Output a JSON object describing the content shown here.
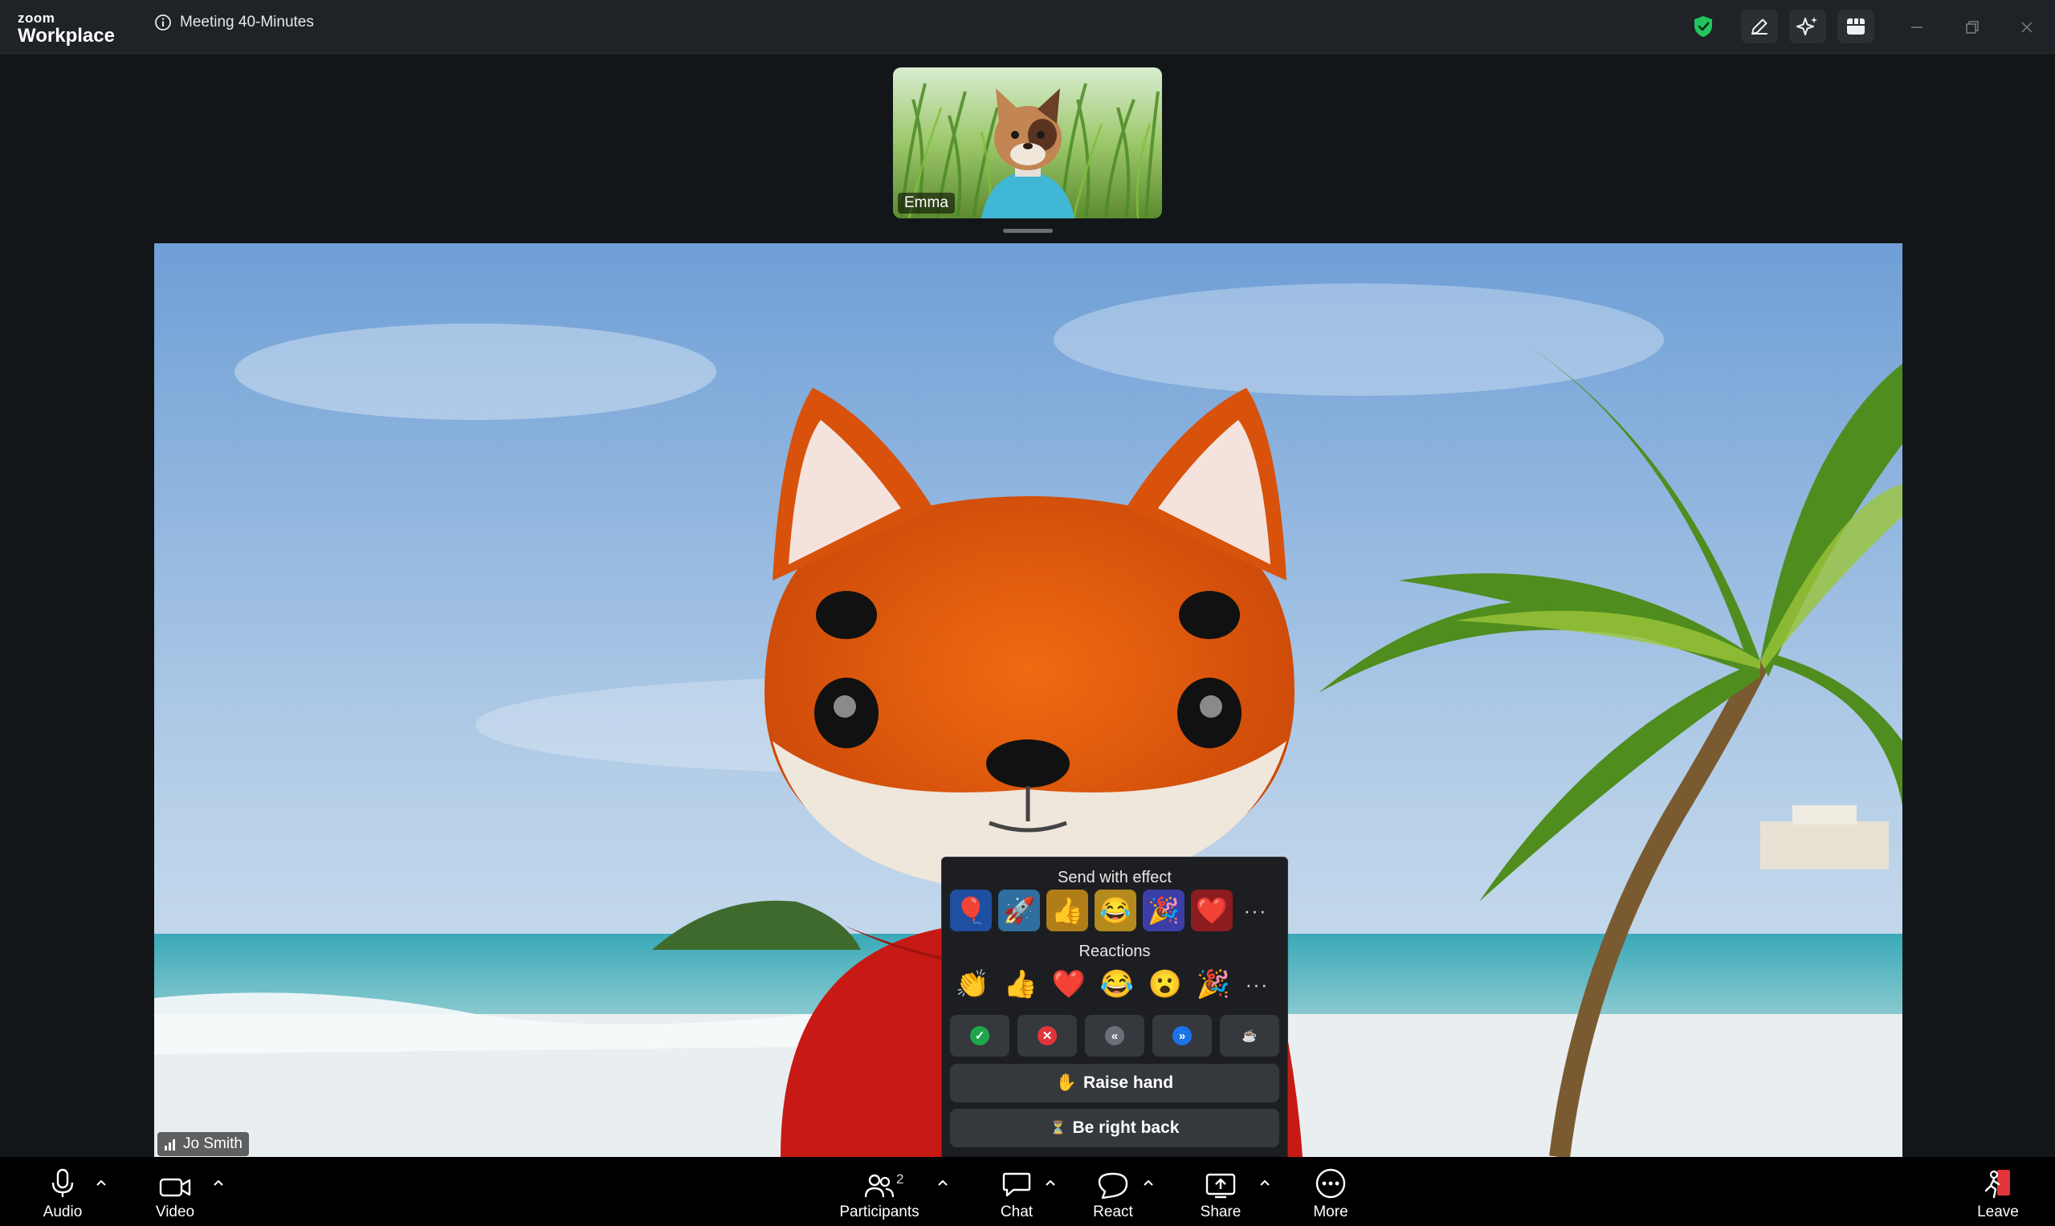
{
  "titlebar": {
    "brand_top": "zoom",
    "brand_bottom": "Workplace",
    "meeting_label": "Meeting 40-Minutes",
    "icons": [
      "info-icon",
      "security-shield-icon",
      "annotate-pencil-icon",
      "ai-companion-sparkle-icon",
      "apps-icon",
      "minimize-icon",
      "restore-icon",
      "close-icon"
    ],
    "shield_color": "#22c55e"
  },
  "participants": {
    "thumbnail_name": "Emma",
    "main_name": "Jo Smith"
  },
  "reactions_panel": {
    "send_with_effect_label": "Send with effect",
    "effects": [
      {
        "icon": "balloon-icon",
        "glyph": "🎈",
        "bg": "#1f4fa0"
      },
      {
        "icon": "rocket-icon",
        "glyph": "🚀",
        "bg": "#2f6e9e"
      },
      {
        "icon": "thumbs-up-effect-icon",
        "glyph": "👍",
        "bg": "#b07d18"
      },
      {
        "icon": "laugh-effect-icon",
        "glyph": "😂",
        "bg": "#b48a1c"
      },
      {
        "icon": "party-effect-icon",
        "glyph": "🎉",
        "bg": "#3c3ea8"
      },
      {
        "icon": "heart-effect-icon",
        "glyph": "❤️",
        "bg": "#8c1c20"
      }
    ],
    "more_label": "···",
    "reactions_label": "Reactions",
    "reactions": [
      {
        "icon": "clap-icon",
        "glyph": "👏"
      },
      {
        "icon": "thumbs-up-icon",
        "glyph": "👍"
      },
      {
        "icon": "heart-icon",
        "glyph": "❤️"
      },
      {
        "icon": "laugh-icon",
        "glyph": "😂"
      },
      {
        "icon": "surprised-icon",
        "glyph": "😮"
      },
      {
        "icon": "party-icon",
        "glyph": "🎉"
      }
    ],
    "status": [
      {
        "icon": "yes-check-icon",
        "glyph": "✓",
        "color": "#1fa64a"
      },
      {
        "icon": "no-x-icon",
        "glyph": "✕",
        "color": "#e0353a"
      },
      {
        "icon": "slow-down-icon",
        "glyph": "«",
        "color": "#6b6f78"
      },
      {
        "icon": "speed-up-icon",
        "glyph": "»",
        "color": "#1a73e8"
      },
      {
        "icon": "coffee-icon",
        "glyph": "☕",
        "color": "#35383d"
      }
    ],
    "raise_hand_glyph": "✋",
    "raise_hand_label": "Raise hand",
    "brb_glyph": "⏳",
    "brb_label": "Be right back"
  },
  "toolbar": {
    "audio_label": "Audio",
    "video_label": "Video",
    "participants_label": "Participants",
    "participants_count": "2",
    "chat_label": "Chat",
    "react_label": "React",
    "share_label": "Share",
    "more_label": "More",
    "leave_label": "Leave",
    "leave_color": "#e0353a"
  }
}
